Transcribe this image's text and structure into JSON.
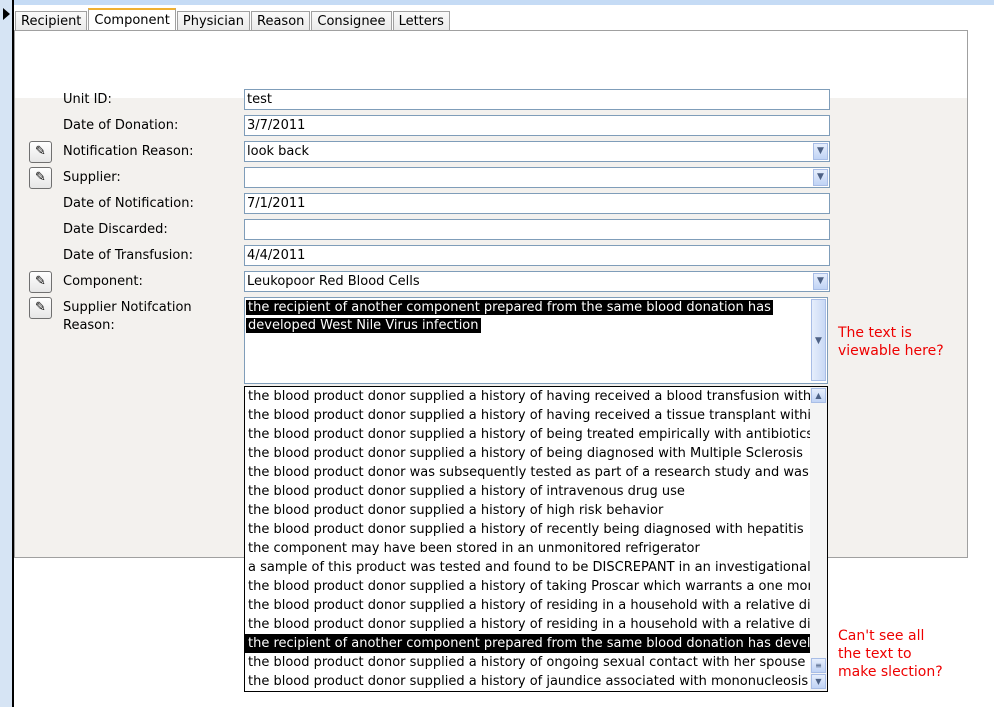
{
  "tabs": [
    "Recipient",
    "Component",
    "Physician",
    "Reason",
    "Consignee",
    "Letters"
  ],
  "active_tab": "Component",
  "fields": {
    "unit_id": {
      "label": "Unit ID:",
      "value": "test"
    },
    "date_of_donation": {
      "label": "Date of Donation:",
      "value": "3/7/2011"
    },
    "notification_reason": {
      "label": "Notification Reason:",
      "value": "look back"
    },
    "supplier": {
      "label": "Supplier:",
      "value": ""
    },
    "date_of_notification": {
      "label": "Date of Notification:",
      "value": "7/1/2011"
    },
    "date_discarded": {
      "label": "Date Discarded:",
      "value": ""
    },
    "date_of_transfusion": {
      "label": "Date of Transfusion:",
      "value": "4/4/2011"
    },
    "component": {
      "label": "Component:",
      "value": "Leukopoor Red Blood Cells"
    },
    "supplier_notification_reason": {
      "label_1": "Supplier Notifcation",
      "label_2": "Reason:",
      "value_line1": "the recipient of another component prepared from the same blood donation has",
      "value_line2": "developed West Nile Virus infection"
    }
  },
  "list_items": [
    "the blood product donor supplied a history of having received a blood transfusion within two",
    "the blood product donor supplied a history of having received a tissue transplant within twe",
    "the blood product donor supplied a history of being treated empirically with antibiotics for",
    "the blood product donor supplied a history of being diagnosed with Multiple Sclerosis",
    "the blood product donor was subsequently tested as part of a research study and was found",
    "the blood product donor supplied a history of intravenous drug use",
    "the blood product donor supplied a history of high risk behavior",
    "the blood product donor supplied a history of recently being diagnosed with hepatitis",
    "the component may have been stored in an unmonitored refrigerator",
    "a sample of this product was tested and found to be DISCREPANT in an investigational test f",
    "the blood product donor supplied a history of taking Proscar which warrants a one month de",
    "the blood product donor supplied a history of residing in a household with a relative diagno",
    "the blood product donor supplied a history of residing in a household with a relative diagno",
    "the recipient of another component prepared from the same blood donation has developed",
    "the blood product donor supplied a history of ongoing sexual contact with her spouse who h",
    "the blood product donor supplied a history of jaundice associated with mononucleosis"
  ],
  "selected_index": 13,
  "notes": {
    "note1_l1": "The text is",
    "note1_l2": "viewable here?",
    "note2_l1": "Can't see all",
    "note2_l2": "the text to",
    "note2_l3": "make slection?"
  }
}
